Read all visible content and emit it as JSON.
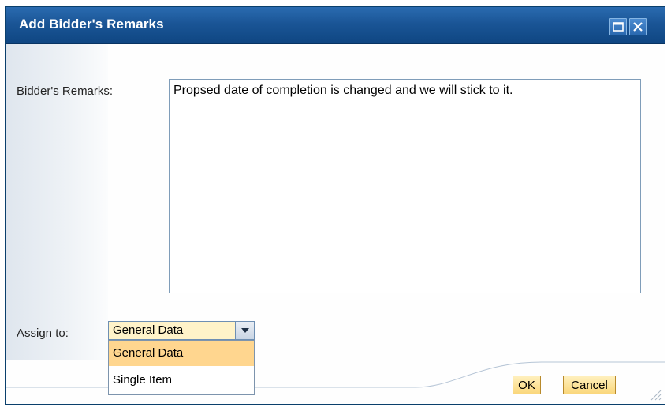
{
  "dialog": {
    "title": "Add Bidder's Remarks",
    "controls": {
      "maximize_icon": "maximize-icon",
      "close_icon": "close-icon"
    }
  },
  "remarks": {
    "label": "Bidder's Remarks:",
    "value": "Propsed date of completion is changed and we will stick to it."
  },
  "assign": {
    "label": "Assign to:",
    "selected": "General Data",
    "options": [
      "General Data",
      "Single Item"
    ]
  },
  "buttons": {
    "ok": "OK",
    "cancel": "Cancel"
  },
  "colors": {
    "titlebar": "#1a5596",
    "selected_option": "#ffd68f",
    "button_fill": "#fad77c"
  }
}
